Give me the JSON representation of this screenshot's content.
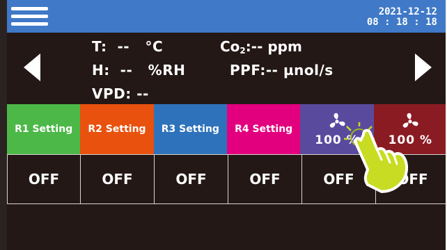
{
  "header": {
    "menu_icon": "hamburger-menu-icon",
    "date": "2021-12-12",
    "time": "08 : 18 : 18",
    "bar_color": "#3f79c7"
  },
  "readings": {
    "temperature": "T:  --   °C",
    "humidity": "H:  --   %RH",
    "vpd": "VPD: --",
    "co2_prefix": "Co",
    "co2_sub": "2",
    "co2_value": ":-- ppm",
    "ppf": "PPF:-- µnol/s"
  },
  "relays": [
    {
      "label": "R1 Setting",
      "color": "#4cb848"
    },
    {
      "label": "R2 Setting",
      "color": "#e9510e"
    },
    {
      "label": "R3 Setting",
      "color": "#2e72bc"
    },
    {
      "label": "R4 Setting",
      "color": "#e3007f"
    },
    {
      "label": "100 %",
      "color": "#5a4a9e",
      "icon": "fan-icon"
    },
    {
      "label": "100 %",
      "color": "#8a1b23",
      "icon": "fan-icon"
    }
  ],
  "states": [
    "OFF",
    "OFF",
    "OFF",
    "OFF",
    "OFF",
    "OFF"
  ],
  "icons": {
    "prev": "left-arrow-icon",
    "next": "right-arrow-icon",
    "pointer": "tap-hand-icon"
  }
}
